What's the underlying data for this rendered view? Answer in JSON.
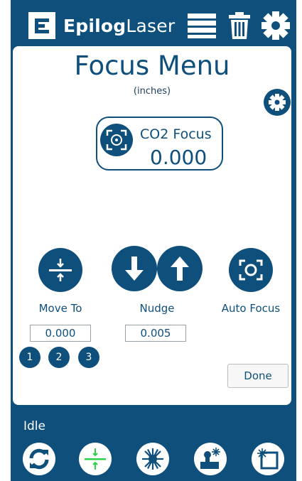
{
  "header": {
    "brand_bold": "Epilog",
    "brand_light": "Laser",
    "icons": [
      "logo-icon",
      "job-list-icon",
      "trash-icon",
      "gear-icon"
    ]
  },
  "main": {
    "title": "Focus Menu",
    "units": "(inches)",
    "focus_card": {
      "label": "CO2 Focus",
      "value": "0.000"
    },
    "controls": {
      "move_to": {
        "label": "Move To",
        "value": "0.000"
      },
      "nudge": {
        "label": "Nudge",
        "value": "0.005"
      },
      "auto_focus": {
        "label": "Auto Focus"
      }
    },
    "presets": [
      "1",
      "2",
      "3"
    ],
    "done_label": "Done"
  },
  "footer": {
    "status": "Idle",
    "icons": [
      "refresh-icon",
      "move-to-icon",
      "laser-icon",
      "jog-icon",
      "frame-icon"
    ]
  },
  "colors": {
    "brand": "#0e4f7c",
    "accent_green": "#2fd04a",
    "white": "#ffffff"
  }
}
